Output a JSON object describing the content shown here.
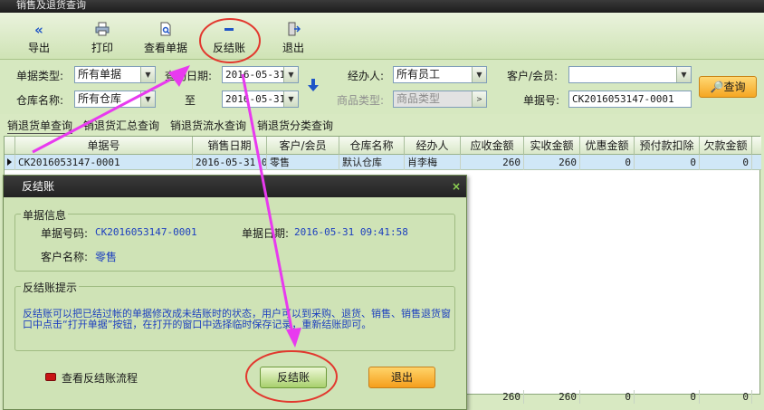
{
  "window": {
    "title": "销售及退货查询"
  },
  "toolbar": {
    "export": "导出",
    "print": "打印",
    "view_doc": "查看单据",
    "unsettle": "反结账",
    "exit": "退出"
  },
  "filters": {
    "doc_type_label": "单据类型:",
    "doc_type_value": "所有单据",
    "query_date_label": "查询日期:",
    "date_from": "2016-05-31",
    "to_label": "至",
    "date_to": "2016-05-31",
    "operator_label": "经办人:",
    "operator_value": "所有员工",
    "customer_label": "客户/会员:",
    "customer_value": "",
    "warehouse_label": "仓库名称:",
    "warehouse_value": "所有仓库",
    "product_type_label": "商品类型:",
    "product_type_value": "商品类型",
    "doc_no_label": "单据号:",
    "doc_no_value": "CK2016053147-0001",
    "query_button": "查询"
  },
  "tabs": [
    "销退货单查询",
    "销退货汇总查询",
    "销退货流水查询",
    "销退货分类查询"
  ],
  "grid": {
    "columns": [
      "单据号",
      "销售日期",
      "客户/会员",
      "仓库名称",
      "经办人",
      "应收金额",
      "实收金额",
      "优惠金额",
      "预付款扣除",
      "欠款金额"
    ],
    "rows": [
      [
        "CK2016053147-0001",
        "2016-05-31 0",
        "零售",
        "默认仓库",
        "肖李梅",
        "260",
        "260",
        "0",
        "0",
        "0"
      ]
    ],
    "totals": [
      "260",
      "260",
      "0",
      "0",
      "0"
    ]
  },
  "dialog": {
    "title": "反结账",
    "close": "×",
    "info_group": "单据信息",
    "doc_no_label": "单据号码:",
    "doc_no_value": "CK2016053147-0001",
    "doc_date_label": "单据日期:",
    "doc_date_value": "2016-05-31 09:41:58",
    "customer_label": "客户名称:",
    "customer_value": "零售",
    "tip_group": "反结账提示",
    "tip_text": "反结账可以把已结过帐的单据修改成未结账时的状态，用户可以到采购、退货、销售、销售退货窗口中点击“打开单据”按钮，在打开的窗口中选择临时保存记录，重新结账即可。",
    "view_flow": "查看反结账流程",
    "confirm": "反结账",
    "cancel": "退出"
  },
  "annotation_color": "#e83aef",
  "circle_color": "#e2382e"
}
